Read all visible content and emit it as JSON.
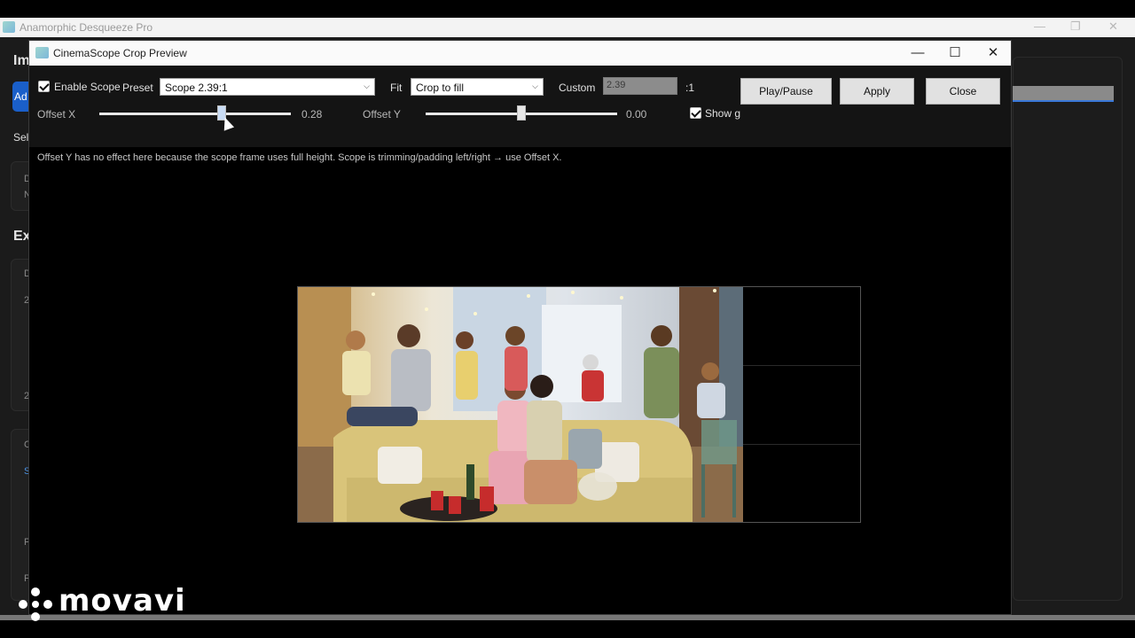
{
  "app": {
    "title": "Anamorphic Desqueeze Pro",
    "window_controls": [
      "—",
      "❐",
      "✕"
    ],
    "left_fragments": {
      "heading1": "Im",
      "blue_button": "Ad",
      "select_label": "Sel",
      "heading2": "Ex",
      "small1": "D",
      "small2": "N",
      "small3": "D",
      "small4": "2",
      "small5": "2",
      "small6": "C",
      "small7": "S",
      "small8": "F",
      "small9": "F"
    }
  },
  "dialog": {
    "title": "CinemaScope Crop Preview",
    "window_controls": {
      "minimize": "—",
      "maximize": "☐",
      "close": "✕"
    },
    "enable_scope_label": "Enable Scope",
    "enable_scope_checked": true,
    "preset_label": "Preset",
    "preset_value": "Scope 2.39:1",
    "fit_label": "Fit",
    "fit_value": "Crop to fill",
    "custom_label": "Custom",
    "custom_value": "2.39",
    "custom_suffix": ":1",
    "play_pause_label": "Play/Pause",
    "apply_label": "Apply",
    "close_label": "Close",
    "offset_x_label": "Offset X",
    "offset_x_value": "0.28",
    "offset_x": 0.28,
    "offset_y_label": "Offset Y",
    "offset_y_value": "0.00",
    "offset_y": 0.0,
    "show_guides_label": "Show gu",
    "show_guides_checked": true,
    "info_text": "Offset Y has no effect here because the scope frame uses full height. Scope is trimming/padding left/right → use Offset X."
  },
  "watermark": {
    "text": "movavi"
  }
}
